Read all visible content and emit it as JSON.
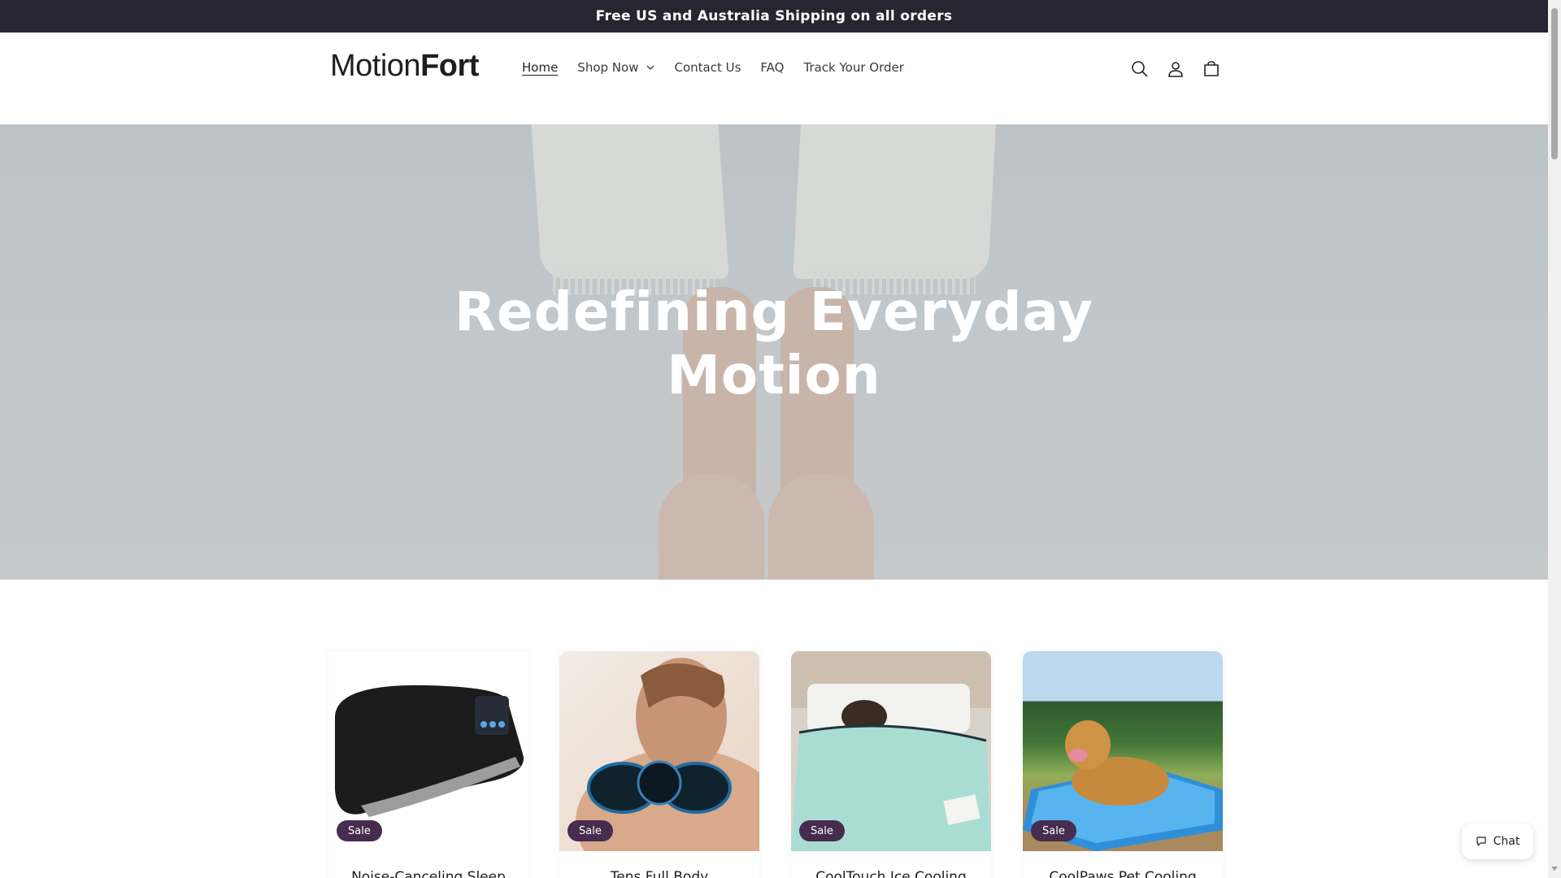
{
  "announcement": {
    "text": "Free US and Australia Shipping on all orders"
  },
  "header": {
    "logo": {
      "light": "Motion",
      "bold": "Fort"
    },
    "nav": [
      {
        "label": "Home"
      },
      {
        "label": "Shop Now"
      },
      {
        "label": "Contact Us"
      },
      {
        "label": "FAQ"
      },
      {
        "label": "Track Your Order"
      }
    ],
    "icons": [
      "search-icon",
      "account-icon",
      "cart-icon"
    ]
  },
  "hero": {
    "title_line1": "Redefining Everyday",
    "title_line2": "Motion"
  },
  "products": [
    {
      "title": "Noise-Canceling Sleep",
      "badge": "Sale"
    },
    {
      "title": "Tens Full Body",
      "badge": "Sale"
    },
    {
      "title": "CoolTouch Ice Cooling",
      "badge": "Sale"
    },
    {
      "title": "CoolPaws Pet Cooling",
      "badge": "Sale"
    }
  ],
  "chat": {
    "label": "Chat"
  },
  "colors": {
    "announcement_bg": "#282532",
    "sale_badge_bg": "#462c4e"
  }
}
